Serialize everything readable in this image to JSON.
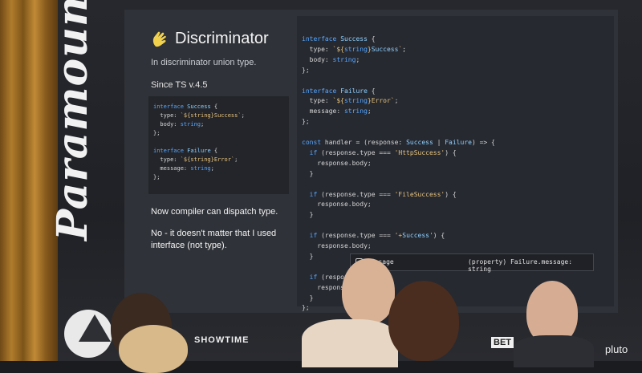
{
  "brand": {
    "name": "Paramount"
  },
  "slide": {
    "title": "Discriminator",
    "title_icon": "hand-wave-icon",
    "subtitle": "In discriminator union type.",
    "since": "Since TS v.4.5",
    "small_code": [
      "interface Success {",
      "  type: `${string}Success`;",
      "  body: string;",
      "};",
      "",
      "interface Failure {",
      "  type: `${string}Error`;",
      "  message: string;",
      "};"
    ],
    "note1": "Now compiler can dispatch type.",
    "note2": "No - it doesn't matter that I used interface (not type)."
  },
  "code": {
    "lines": [
      "interface Success {",
      "  type: `${string}Success`;",
      "  body: string;",
      "};",
      "",
      "interface Failure {",
      "  type: `${string}Error`;",
      "  message: string;",
      "};",
      "",
      "const handler = (response: Success | Failure) => {",
      "  if (response.type === 'HttpSuccess') {",
      "    response.body;",
      "  }",
      "",
      "  if (response.type === 'FileSuccess') {",
      "    response.body;",
      "  }",
      "",
      "  if (response.type === '+Success') {",
      "    response.body;",
      "  }",
      "",
      "  if (response",
      "    respons",
      "  }",
      "};"
    ],
    "tooltip": {
      "icon": "property-icon",
      "name": "message",
      "detail": "(property) Failure.message: string"
    }
  },
  "logos": [
    "SHOWTIME",
    "BET",
    "pluto"
  ]
}
